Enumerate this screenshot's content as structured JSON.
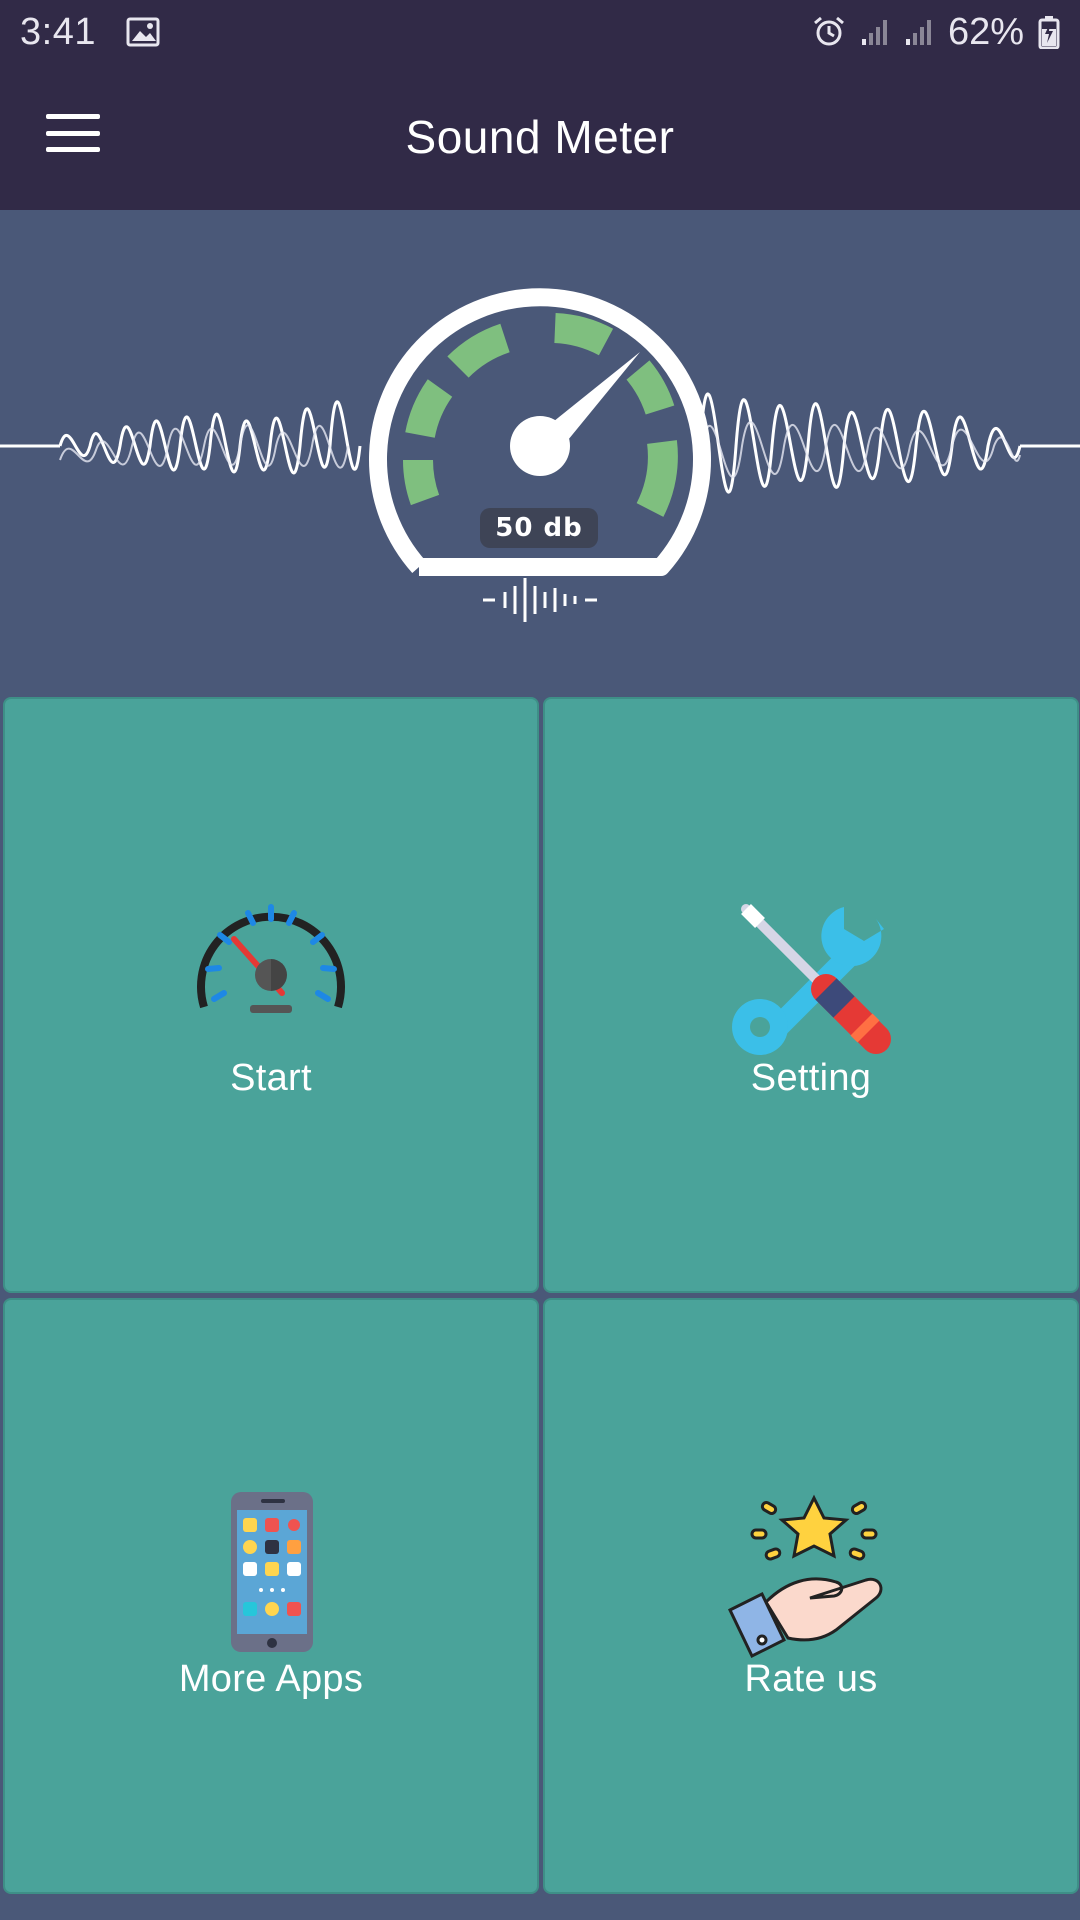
{
  "status_bar": {
    "time": "3:41",
    "battery": "62%",
    "icons": [
      "gallery-icon",
      "alarm-icon",
      "signal-icon",
      "signal-icon",
      "battery-charging-icon"
    ]
  },
  "app_bar": {
    "title": "Sound Meter",
    "menu_icon": "hamburger-menu-icon"
  },
  "hero": {
    "reading": "50 db"
  },
  "tiles": [
    {
      "label": "Start",
      "icon": "speedometer-icon"
    },
    {
      "label": "Setting",
      "icon": "tools-icon"
    },
    {
      "label": "More Apps",
      "icon": "smartphone-apps-icon"
    },
    {
      "label": "Rate us",
      "icon": "hand-star-icon"
    }
  ],
  "colors": {
    "app_bar": "#312a47",
    "hero_bg": "#4a5878",
    "tile": "#4aa39a",
    "gauge_green": "#7fbf7f"
  }
}
